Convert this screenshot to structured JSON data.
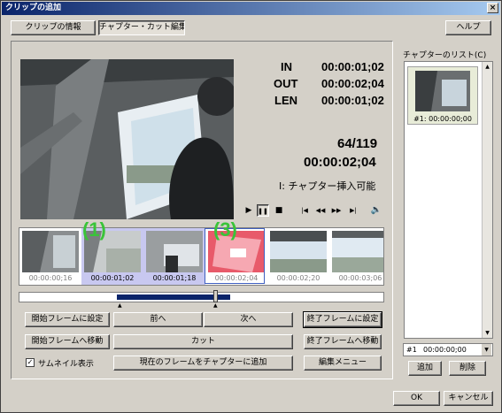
{
  "window": {
    "title": "クリップの追加",
    "close": "×"
  },
  "tabs": {
    "clip_info": "クリップの情報",
    "chapter_cut": "チャプター・カット編集",
    "help": "ヘルプ"
  },
  "timecode": {
    "in_label": "IN",
    "in_value": "00:00:01;02",
    "out_label": "OUT",
    "out_value": "00:00:02;04",
    "len_label": "LEN",
    "len_value": "00:00:01;02",
    "frame_counter": "64/119",
    "current_time": "00:00:02;04",
    "chapter_status": "I: チャプター挿入可能"
  },
  "transport": {
    "play": "▶",
    "pause": "❚❚",
    "stop": "■",
    "first": "|◀",
    "prev": "◀◀",
    "next": "▶▶",
    "last": "▶|",
    "volume": "🔈"
  },
  "thumbnails": [
    {
      "time": "00:00:00;16",
      "selected": false
    },
    {
      "time": "00:00:01;02",
      "selected": true
    },
    {
      "time": "00:00:01;18",
      "selected": true
    },
    {
      "time": "00:00:02;04",
      "selected": false
    },
    {
      "time": "00:00:02;20",
      "selected": false
    },
    {
      "time": "00:00:03;06",
      "selected": false
    }
  ],
  "markers": {
    "m1": "(1)",
    "m3": "(3)"
  },
  "buttons": {
    "set_start": "開始フレームに設定",
    "prev": "前へ",
    "next": "次へ",
    "set_end": "終了フレームに設定",
    "go_start": "開始フレームへ移動",
    "cut": "カット",
    "go_end": "終了フレームへ移動",
    "add_chapter": "現在のフレームをチャプターに追加",
    "edit_menu": "編集メニュー",
    "ok": "OK",
    "cancel": "キャンセル"
  },
  "thumbnail_checkbox": {
    "label": "サムネイル表示",
    "checked": "✓"
  },
  "chapter_list": {
    "title": "チャプターのリスト(C)",
    "items": [
      {
        "label": "#1: 00:00:00;00"
      }
    ],
    "select_num": "#1",
    "select_time": "00:00:00;00",
    "add": "追加",
    "delete": "削除"
  },
  "colors": {
    "marker": "#39c439",
    "selection": "#c8c8f0",
    "scroll_range": "#0a246a"
  }
}
